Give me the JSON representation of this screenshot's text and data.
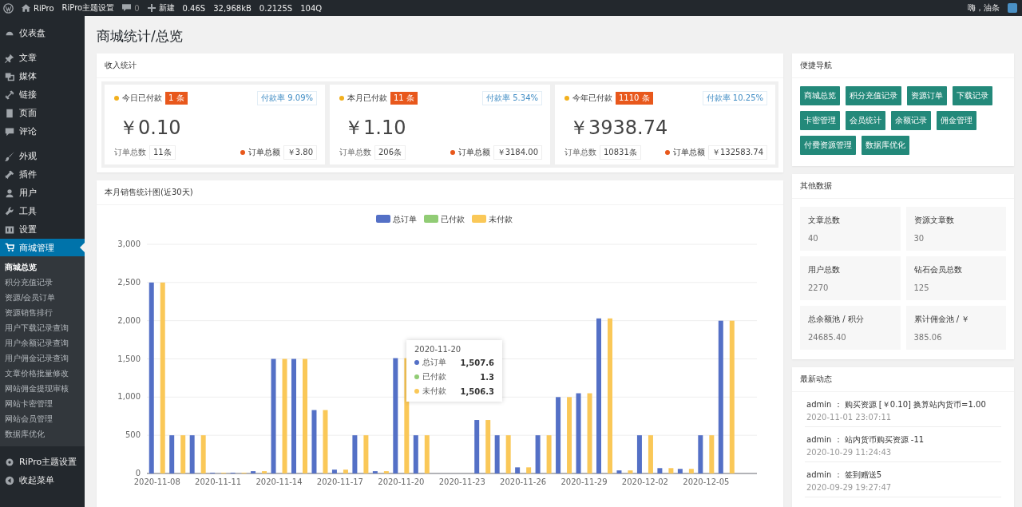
{
  "admin_bar": {
    "site": "RiPro",
    "theme_settings": "RiPro主题设置",
    "comments": "0",
    "new": "新建",
    "stats": [
      "0.46S",
      "32,968kB",
      "0.2125S",
      "104Q"
    ],
    "greeting": "嗨，油条"
  },
  "sidebar": {
    "items": [
      {
        "label": "仪表盘",
        "selected": false
      },
      {
        "label": "文章",
        "selected": false
      },
      {
        "label": "媒体",
        "selected": false
      },
      {
        "label": "链接",
        "selected": false
      },
      {
        "label": "页面",
        "selected": false
      },
      {
        "label": "评论",
        "selected": false
      },
      {
        "label": "外观",
        "selected": false
      },
      {
        "label": "插件",
        "selected": false
      },
      {
        "label": "用户",
        "selected": false
      },
      {
        "label": "工具",
        "selected": false
      },
      {
        "label": "设置",
        "selected": false
      },
      {
        "label": "商城管理",
        "selected": true
      }
    ],
    "submenu": [
      {
        "label": "商城总览",
        "selected": true
      },
      {
        "label": "积分充值记录",
        "selected": false
      },
      {
        "label": "资源/会员订单",
        "selected": false
      },
      {
        "label": "资源销售排行",
        "selected": false
      },
      {
        "label": "用户下载记录查询",
        "selected": false
      },
      {
        "label": "用户余额记录查询",
        "selected": false
      },
      {
        "label": "用户佣金记录查询",
        "selected": false
      },
      {
        "label": "文章价格批量修改",
        "selected": false
      },
      {
        "label": "网站佣金提现审核",
        "selected": false
      },
      {
        "label": "网站卡密管理",
        "selected": false
      },
      {
        "label": "网站会员管理",
        "selected": false
      },
      {
        "label": "数据库优化",
        "selected": false
      }
    ],
    "after": [
      {
        "label": "RiPro主题设置",
        "selected": false
      },
      {
        "label": "收起菜单",
        "selected": false
      }
    ]
  },
  "page_title": "商城统计/总览",
  "income": {
    "title": "收入统计",
    "cards": [
      {
        "label": "今日已付款",
        "badge": "1 条",
        "rate": "付款率 9.09%",
        "amount": "￥0.10",
        "orders_label": "订单总数",
        "orders": "11条",
        "total_label": "订单总额",
        "total": "￥3.80"
      },
      {
        "label": "本月已付款",
        "badge": "11 条",
        "rate": "付款率 5.34%",
        "amount": "￥1.10",
        "orders_label": "订单总数",
        "orders": "206条",
        "total_label": "订单总额",
        "total": "￥3184.00"
      },
      {
        "label": "今年已付款",
        "badge": "1110 条",
        "rate": "付款率 10.25%",
        "amount": "￥3938.74",
        "orders_label": "订单总数",
        "orders": "10831条",
        "total_label": "订单总额",
        "total": "￥132583.74"
      }
    ]
  },
  "sales": {
    "title": "本月销售统计图(近30天)",
    "chart_data": {
      "type": "bar",
      "categories": [
        "2020-11-08",
        null,
        null,
        "2020-11-11",
        null,
        null,
        "2020-11-14",
        null,
        null,
        "2020-11-17",
        null,
        null,
        "2020-11-20",
        null,
        null,
        "2020-11-23",
        null,
        null,
        "2020-11-26",
        null,
        null,
        "2020-11-29",
        null,
        null,
        "2020-12-02",
        null,
        null,
        "2020-12-05",
        null,
        null
      ],
      "grid": true,
      "legend": "top",
      "stacked": false,
      "series": [
        {
          "name": "总订单",
          "color": "#5470c6",
          "values": [
            2500,
            500,
            500,
            10,
            10,
            30,
            1500,
            1500,
            830,
            50,
            500,
            30,
            1510,
            500,
            0,
            0,
            700,
            500,
            80,
            500,
            1000,
            1050,
            2030,
            40,
            500,
            70,
            60,
            500,
            2000,
            0
          ]
        },
        {
          "name": "已付款",
          "color": "#91cc75",
          "values": [
            0,
            0,
            0,
            0,
            0,
            0,
            0,
            0,
            0,
            0,
            0,
            0,
            0,
            0,
            0,
            0,
            0,
            0,
            0,
            0,
            0,
            0,
            0,
            0,
            0,
            0,
            0,
            0,
            0,
            0
          ]
        },
        {
          "name": "未付款",
          "color": "#fac858",
          "values": [
            2500,
            500,
            500,
            10,
            10,
            30,
            1500,
            1500,
            830,
            50,
            500,
            30,
            1510,
            500,
            0,
            0,
            700,
            500,
            80,
            500,
            1000,
            1050,
            2030,
            40,
            500,
            70,
            60,
            500,
            2000,
            0
          ]
        }
      ],
      "ylim": [
        0,
        3000
      ],
      "yticks": [
        {
          "value": 0,
          "label": "0"
        },
        {
          "value": 500,
          "label": "500"
        },
        {
          "value": 1000,
          "label": "1,000"
        },
        {
          "value": 1500,
          "label": "1,500"
        },
        {
          "value": 2000,
          "label": "2,000"
        },
        {
          "value": 2500,
          "label": "2,500"
        },
        {
          "value": 3000,
          "label": "3,000"
        }
      ],
      "orientation": "vertical"
    },
    "tooltip": {
      "title": "2020-11-20",
      "rows": [
        {
          "name": "总订单",
          "value": "1,507.6"
        },
        {
          "name": "已付款",
          "value": "1.3"
        },
        {
          "name": "未付款",
          "value": "1,506.3"
        }
      ]
    }
  },
  "quick_nav": {
    "title": "便捷导航",
    "buttons": [
      "商城总览",
      "积分充值记录",
      "资源订单",
      "下载记录",
      "卡密管理",
      "会员统计",
      "余额记录",
      "佣金管理",
      "付费资源管理",
      "数据库优化"
    ]
  },
  "other_data": {
    "title": "其他数据",
    "items": [
      {
        "label": "文章总数",
        "value": "40"
      },
      {
        "label": "资源文章数",
        "value": "30"
      },
      {
        "label": "用户总数",
        "value": "2270"
      },
      {
        "label": "钻石会员总数",
        "value": "125"
      },
      {
        "label": "总余额池 / 积分",
        "value": "24685.40"
      },
      {
        "label": "累计佣金池 / ￥",
        "value": "385.06"
      }
    ]
  },
  "activity": {
    "title": "最新动态",
    "items": [
      {
        "text": "admin ： 购买资源 [￥0.10] 换算站内货币=1.00",
        "time": "2020-11-01 23:07:11"
      },
      {
        "text": "admin ： 站内货币购买资源 -11",
        "time": "2020-10-29 11:24:43"
      },
      {
        "text": "admin ： 签到赠送5",
        "time": "2020-09-29 19:27:47"
      }
    ]
  }
}
